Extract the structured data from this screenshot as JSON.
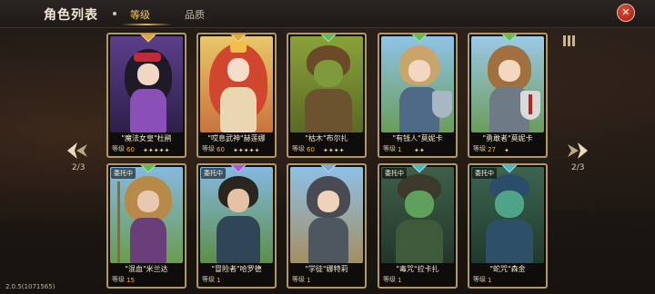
{
  "header": {
    "title": "角色列表",
    "tabs": [
      {
        "label": "等级",
        "active": true
      },
      {
        "label": "品质",
        "active": false
      }
    ],
    "close_icon": "close-icon"
  },
  "pagination": {
    "left": "2/3",
    "right": "2/3"
  },
  "version": "2.0.5(1071565)",
  "level_label": "等级",
  "colors": {
    "accent": "#f4c96a",
    "close": "#c92b20",
    "frame": "#b49863"
  },
  "cards": [
    {
      "name": "\"魔法女皇\"杜鹃",
      "level": "60",
      "stars": "✦✦✦✦✦",
      "gem": "#e0a73a",
      "badge": ""
    },
    {
      "name": "\"哎息武神\"赫莲娜",
      "level": "60",
      "stars": "✦✦✦✦✦",
      "gem": "#e0a73a",
      "badge": ""
    },
    {
      "name": "\"枯木\"布尔扎",
      "level": "60",
      "stars": "✦✦✦✦",
      "gem": "#5bbd55",
      "badge": ""
    },
    {
      "name": "\"有钱人\"莫妮卡",
      "level": "1",
      "stars": "✦✦",
      "gem": "#5bbd55",
      "badge": ""
    },
    {
      "name": "\"勇敢者\"莫妮卡",
      "level": "27",
      "stars": "✦",
      "gem": "#5bbd55",
      "badge": ""
    },
    {
      "name": "\"混血\"米兰达",
      "level": "15",
      "stars": "",
      "gem": "#5bbd55",
      "badge": "委托中"
    },
    {
      "name": "\"冒险者\"哈罗德",
      "level": "1",
      "stars": "",
      "gem": "#a65ad6",
      "badge": "委托中"
    },
    {
      "name": "\"学徒\"娜特莉",
      "level": "1",
      "stars": "",
      "gem": "#7aa9d8",
      "badge": ""
    },
    {
      "name": "\"毒咒\"拉卡扎",
      "level": "1",
      "stars": "",
      "gem": "#4ab6c8",
      "badge": "委托中"
    },
    {
      "name": "\"蛇咒\"森金",
      "level": "1",
      "stars": "",
      "gem": "#4ab6c8",
      "badge": "委托中"
    }
  ]
}
